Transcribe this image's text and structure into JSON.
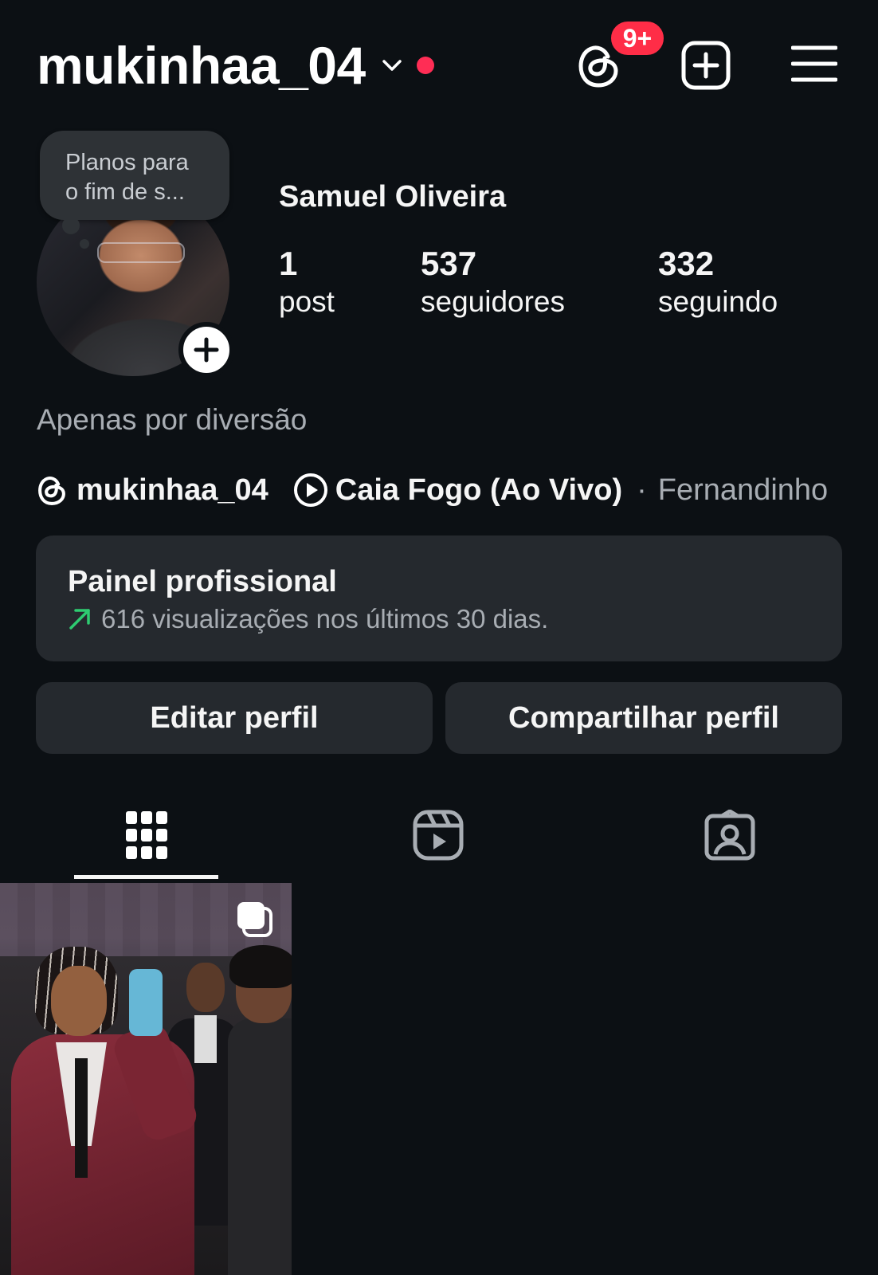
{
  "header": {
    "username": "mukinhaa_04",
    "notification_badge": "9+",
    "badge_color": "#ff2d47",
    "status_dot_color": "#ff2d55",
    "icons": [
      "chevron-down-icon",
      "threads-icon",
      "create-icon",
      "menu-icon"
    ]
  },
  "profile": {
    "note_line1": "Planos para",
    "note_line2": "o fim de s...",
    "full_name": "Samuel Oliveira",
    "stats": {
      "posts_count": "1",
      "posts_label": "post",
      "followers_count": "537",
      "followers_label": "seguidores",
      "following_count": "332",
      "following_label": "seguindo"
    },
    "bio": "Apenas por diversão",
    "threads_link": "mukinhaa_04",
    "music": {
      "song": "Caia Fogo (Ao Vivo)",
      "separator": "·",
      "artist": "Fernandinho"
    }
  },
  "dashboard": {
    "title": "Painel profissional",
    "subtitle": "616 visualizações nos últimos 30 dias.",
    "trend_color": "#2ecc71"
  },
  "actions": {
    "edit_label": "Editar perfil",
    "share_label": "Compartilhar perfil"
  },
  "tabs": {
    "items": [
      "grid-icon",
      "reels-icon",
      "tagged-icon"
    ],
    "active": "grid-icon"
  },
  "posts": [
    {
      "type": "carousel",
      "icon": "multiple-photos-icon"
    }
  ]
}
